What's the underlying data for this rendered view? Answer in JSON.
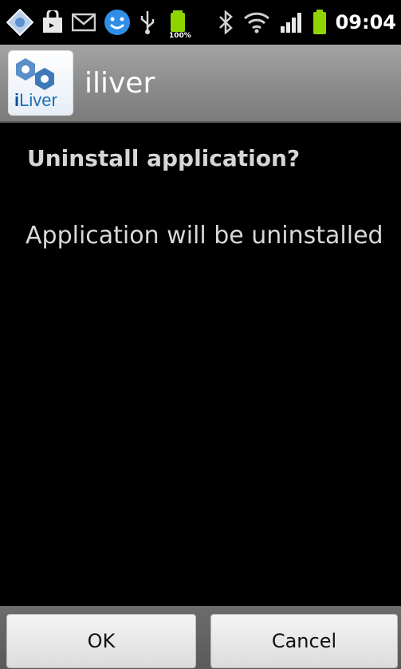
{
  "status_bar": {
    "clock": "09:04",
    "battery_badge": "100%",
    "icons": [
      "diamond-app-icon",
      "shopping-bag-icon",
      "gmail-icon",
      "smiley-icon",
      "usb-icon",
      "battery-charging-icon",
      "bluetooth-icon",
      "wifi-icon",
      "signal-icon",
      "battery-icon"
    ]
  },
  "title_bar": {
    "app_icon_text_i": "i",
    "app_icon_text_rest": "Liver",
    "title": "iliver"
  },
  "dialog": {
    "heading": "Uninstall application?",
    "message": "Application will be uninstalled"
  },
  "buttons": {
    "ok_label": "OK",
    "cancel_label": "Cancel"
  },
  "colors": {
    "accent_smiley": "#2f8fe8",
    "battery_green": "#8fd400"
  }
}
